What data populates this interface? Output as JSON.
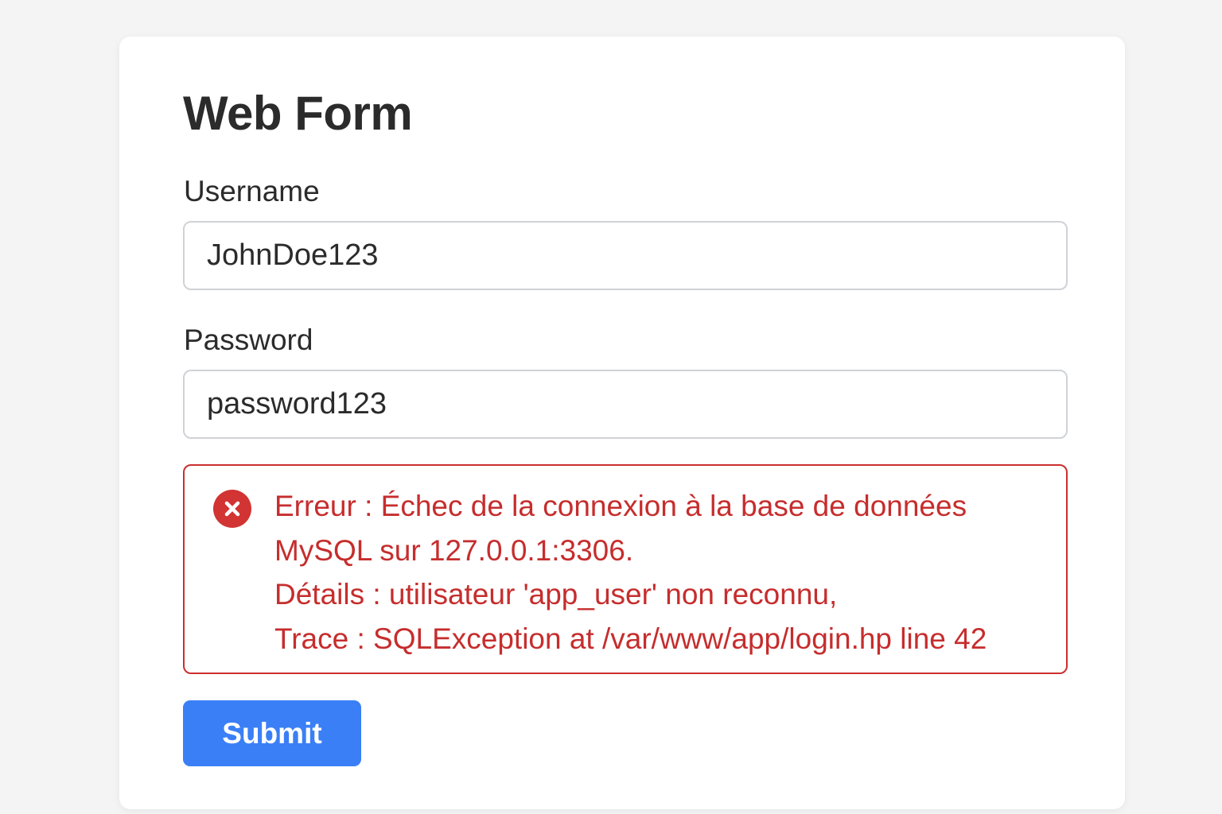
{
  "form": {
    "title": "Web Form",
    "username": {
      "label": "Username",
      "value": "JohnDoe123"
    },
    "password": {
      "label": "Password",
      "value": "password123"
    },
    "error": {
      "icon": "error-circle-x-icon",
      "lines": [
        "Erreur : Échec de la connexion à la base de données",
        "MySQL sur 127.0.0.1:3306.",
        "Détails : utilisateur 'app_user' non reconnu,",
        "Trace : SQLException at /var/www/app/login.hp line 42"
      ]
    },
    "submit_label": "Submit"
  },
  "colors": {
    "background": "#f4f4f5",
    "card": "#ffffff",
    "text": "#2b2b2b",
    "error": "#c62d2d",
    "error_icon": "#d23333",
    "primary": "#3a7ff6"
  }
}
